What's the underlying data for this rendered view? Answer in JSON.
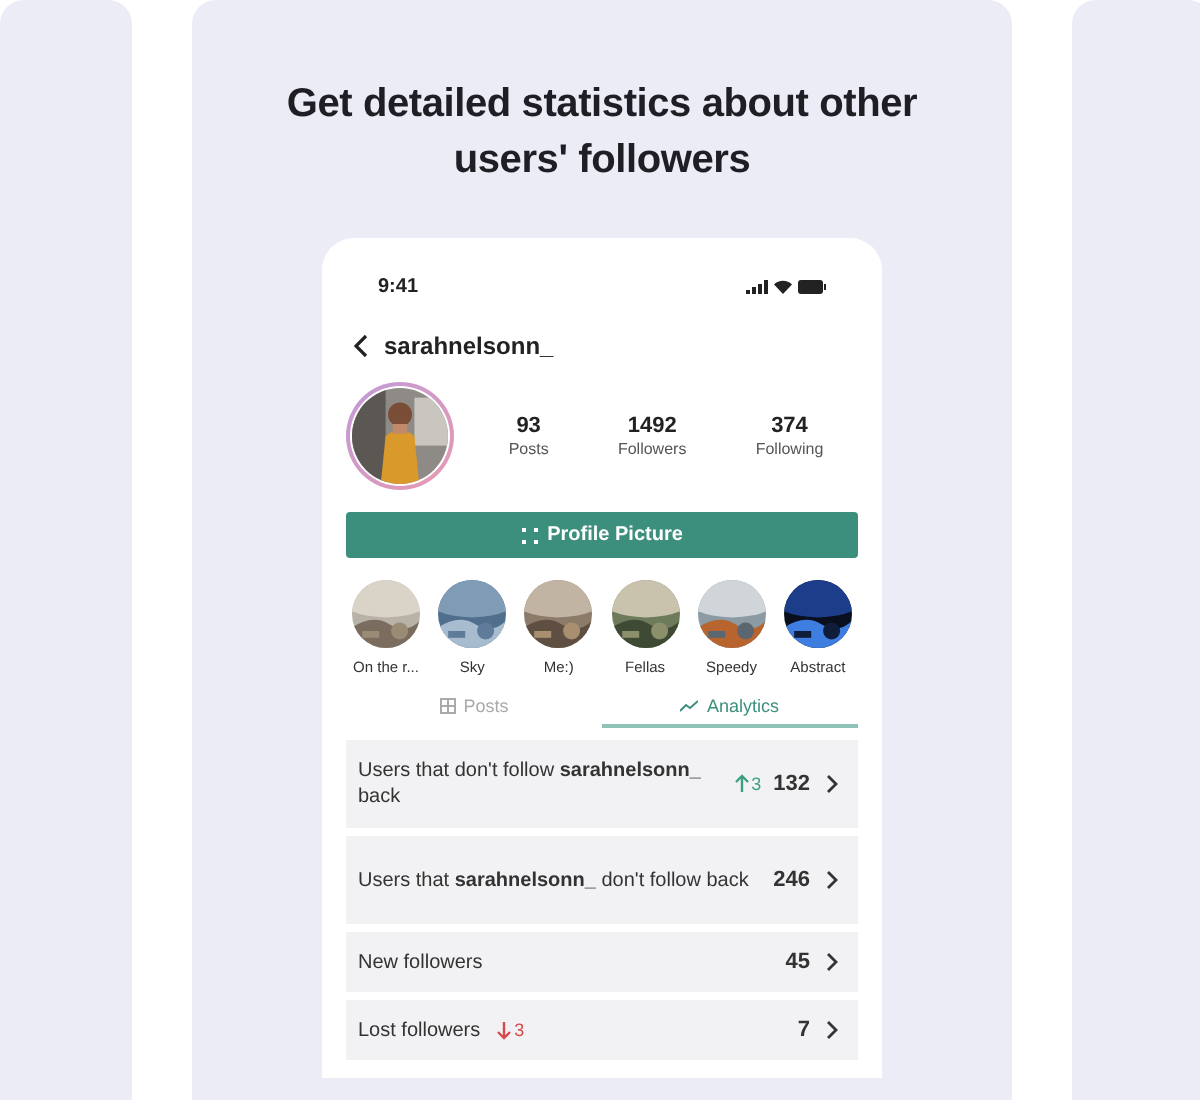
{
  "headline": "Get detailed statistics about other users' followers",
  "phone": {
    "status_bar": {
      "time": "9:41"
    },
    "username": "sarahnelsonn_",
    "stats": [
      {
        "value": "93",
        "label": "Posts"
      },
      {
        "value": "1492",
        "label": "Followers"
      },
      {
        "value": "374",
        "label": "Following"
      }
    ],
    "profile_button": "Profile Picture",
    "highlights": [
      {
        "label": "On the r..."
      },
      {
        "label": "Sky"
      },
      {
        "label": "Me:)"
      },
      {
        "label": "Fellas"
      },
      {
        "label": "Speedy"
      },
      {
        "label": "Abstract"
      }
    ],
    "tabs": [
      {
        "label": "Posts",
        "selected": false
      },
      {
        "label": "Analytics",
        "selected": true
      }
    ],
    "rows": [
      {
        "text": "Users that don't follow **sarahnelsonn_** back",
        "change": {
          "kind": "increase",
          "text": "3"
        },
        "count": "132"
      },
      {
        "text": "Users that **sarahnelsonn_** don't follow back",
        "count": "246"
      },
      {
        "text": "New followers",
        "count": "45"
      },
      {
        "text": "Lost followers",
        "change": {
          "kind": "decrease",
          "text": "3"
        },
        "count": "7"
      }
    ]
  }
}
